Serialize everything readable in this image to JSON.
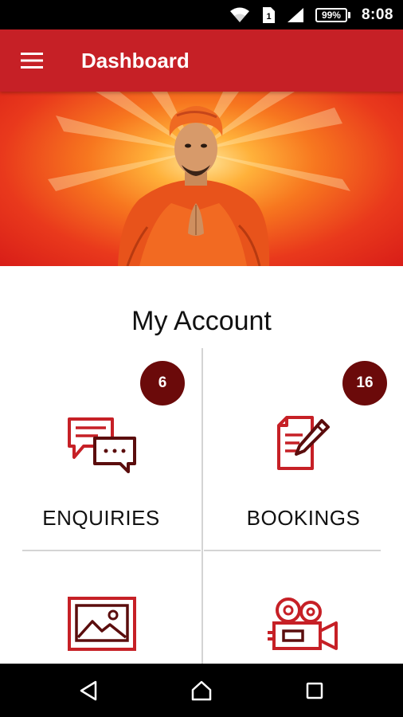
{
  "status_bar": {
    "battery": "99%",
    "time": "8:08",
    "sim_label": "1",
    "icons": [
      "wifi-icon",
      "sim-icon",
      "signal-icon",
      "battery-icon"
    ]
  },
  "app_bar": {
    "title": "Dashboard",
    "menu_icon": "hamburger-menu-icon"
  },
  "colors": {
    "primary": "#c62026",
    "badge": "#6b0a0a",
    "icon_dark": "#5b0d0d"
  },
  "section": {
    "title": "My Account"
  },
  "tiles": [
    {
      "label": "ENQUIRIES",
      "badge": "6",
      "icon": "chat-bubbles-icon"
    },
    {
      "label": "BOOKINGS",
      "badge": "16",
      "icon": "document-pen-icon"
    },
    {
      "label": "",
      "icon": "image-gallery-icon"
    },
    {
      "label": "",
      "icon": "video-camera-icon"
    }
  ],
  "nav_bar": {
    "icons": [
      "back-icon",
      "home-icon",
      "recents-icon"
    ]
  }
}
